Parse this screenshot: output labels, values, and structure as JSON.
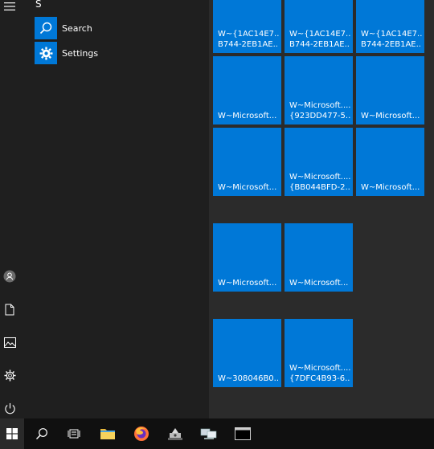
{
  "applist": {
    "letter": "S",
    "items": [
      {
        "label": "Search",
        "icon": "search-icon"
      },
      {
        "label": "Settings",
        "icon": "gear-icon"
      }
    ]
  },
  "tiles": [
    {
      "line1": "W~{1AC14E7...",
      "line2": "B744-2EB1AE..."
    },
    {
      "line1": "W~{1AC14E7...",
      "line2": "B744-2EB1AE..."
    },
    {
      "line1": "W~{1AC14E7...",
      "line2": "B744-2EB1AE..."
    },
    {
      "line1": "W~Microsoft...",
      "line2": ""
    },
    {
      "line1": "W~Microsoft....",
      "line2": "{923DD477-5..."
    },
    {
      "line1": "W~Microsoft...",
      "line2": ""
    },
    {
      "line1": "W~Microsoft...",
      "line2": ""
    },
    {
      "line1": "W~Microsoft....",
      "line2": "{BB044BFD-2..."
    },
    {
      "line1": "W~Microsoft...",
      "line2": ""
    },
    {
      "line1": "W~Microsoft...",
      "line2": ""
    },
    {
      "line1": "W~Microsoft...",
      "line2": ""
    },
    {
      "line1": "W~308046B0...",
      "line2": ""
    },
    {
      "line1": "W~Microsoft....",
      "line2": "{7DFC4B93-6..."
    }
  ],
  "taskbar": {
    "items": [
      "windows-start-icon",
      "search-icon",
      "task-view-icon",
      "file-explorer-icon",
      "firefox-icon",
      "app-icon",
      "network-icon",
      "terminal-icon"
    ]
  },
  "colors": {
    "tile": "#0078d7",
    "taskbar": "#101010",
    "panel": "#1f1f1f"
  }
}
